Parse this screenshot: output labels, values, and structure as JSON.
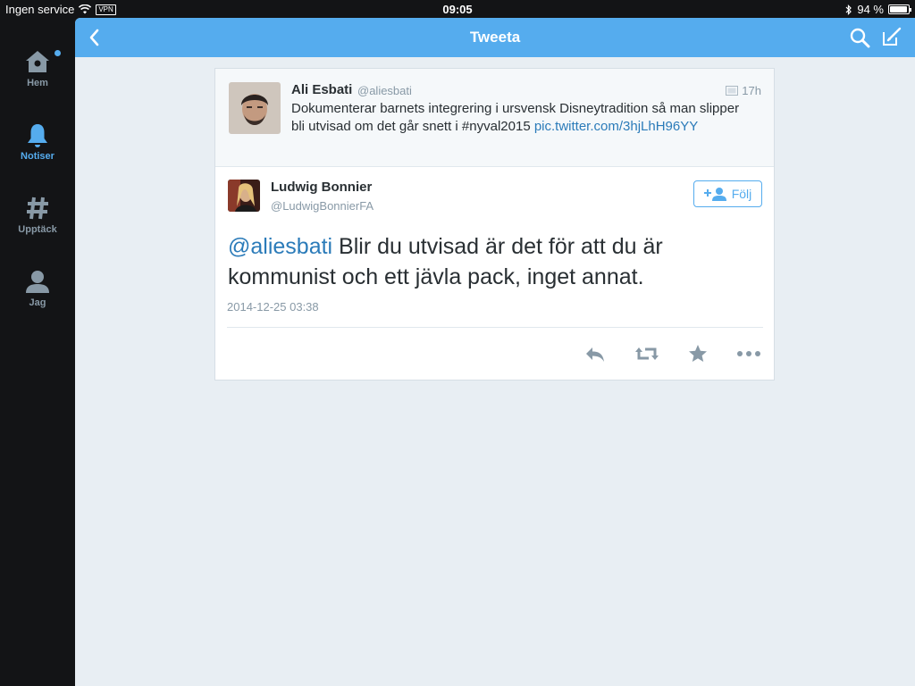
{
  "status_bar": {
    "carrier": "Ingen service",
    "vpn": "VPN",
    "time": "09:05",
    "battery": "94 %",
    "battery_level": 0.94
  },
  "sidebar": {
    "items": [
      {
        "label": "Hem",
        "icon": "home-icon",
        "active": false,
        "notification_dot": true
      },
      {
        "label": "Notiser",
        "icon": "bell-icon",
        "active": true
      },
      {
        "label": "Upptäck",
        "icon": "hashtag-icon",
        "active": false
      },
      {
        "label": "Jag",
        "icon": "person-icon",
        "active": false
      }
    ]
  },
  "navbar": {
    "title": "Tweeta"
  },
  "parent_tweet": {
    "name": "Ali Esbati",
    "handle": "@aliesbati",
    "time": "17h",
    "text": "Dokumenterar barnets integrering i ursvensk Disneytradition så man slipper bli utvisad om det går snett i #nyval2015 ",
    "link": "pic.twitter.com/3hjLhH96YY"
  },
  "main_tweet": {
    "name": "Ludwig Bonnier",
    "handle": "@LudwigBonnierFA",
    "mention": "@aliesbati",
    "text": " Blir du utvisad är det för att du är kommunist och ett jävla pack, inget annat.",
    "date": "2014-12-25 03:38",
    "follow_label": "Följ"
  },
  "colors": {
    "accent": "#55acee",
    "link": "#2b7bb9",
    "muted": "#8899a6",
    "sidebar_bg": "#131416",
    "panel_bg": "#e8eef3"
  }
}
